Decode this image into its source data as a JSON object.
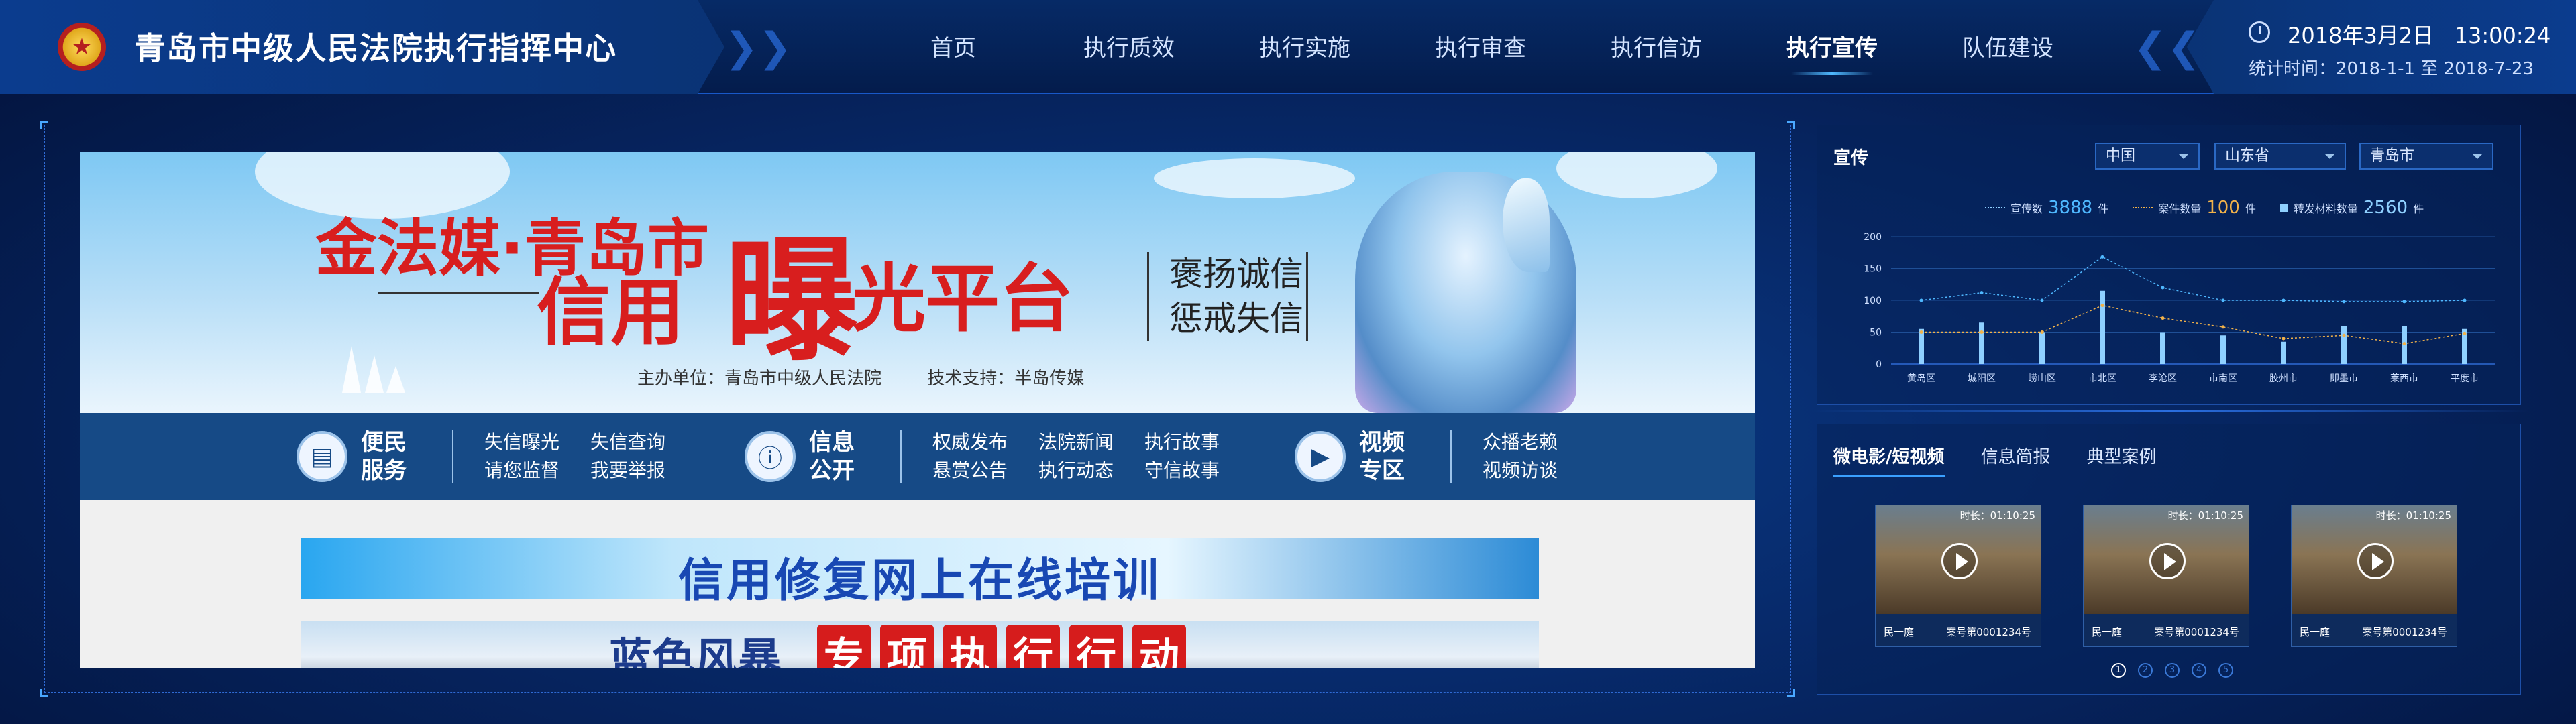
{
  "header": {
    "title": "青岛市中级人民法院执行指挥中心",
    "emblem_icon": "court-emblem-icon",
    "nav": [
      {
        "label": "首页",
        "active": false
      },
      {
        "label": "执行质效",
        "active": false
      },
      {
        "label": "执行实施",
        "active": false
      },
      {
        "label": "执行审查",
        "active": false
      },
      {
        "label": "执行信访",
        "active": false
      },
      {
        "label": "执行宣传",
        "active": true
      },
      {
        "label": "队伍建设",
        "active": false
      }
    ],
    "datetime": "2018年3月2日   13:00:24",
    "stats_range": "统计时间：2018-1-1 至 2018-7-23"
  },
  "banner": {
    "title_prefix": "金法媒·青岛市",
    "title_main_a": "信用",
    "title_main_big": "曝",
    "title_main_b": "光平台",
    "slogan_1": "褒扬诚信",
    "slogan_2": "惩戒失信",
    "sponsor": "主办单位：青岛市中级人民法院",
    "tech": "技术支持：半岛传媒",
    "groups": [
      {
        "icon": "newspaper-icon",
        "head_1": "便民",
        "head_2": "服务",
        "links": [
          "失信曝光",
          "失信查询",
          "请您监督",
          "我要举报"
        ]
      },
      {
        "icon": "info-icon",
        "head_1": "信息",
        "head_2": "公开",
        "links": [
          "权威发布",
          "法院新闻",
          "执行故事",
          "悬赏公告",
          "执行动态",
          "守信故事"
        ]
      },
      {
        "icon": "film-icon",
        "head_1": "视频",
        "head_2": "专区",
        "links": [
          "众播老赖",
          "视频访谈"
        ]
      }
    ],
    "strip_1": "信用修复网上在线培训",
    "strip_2_a": "蓝色风暴",
    "strip_2_b": [
      "专",
      "项",
      "执",
      "行",
      "行",
      "动"
    ]
  },
  "publicity": {
    "title": "宣传",
    "selects": [
      "中国",
      "山东省",
      "青岛市"
    ],
    "legend": [
      {
        "label": "宣传数",
        "value": "3888",
        "unit": "件",
        "color": "#4fb8ff"
      },
      {
        "label": "案件数量",
        "value": "100",
        "unit": "件",
        "color": "#f2b24a"
      },
      {
        "label": "转发材料数量",
        "value": "2560",
        "unit": "件",
        "color": "#8fd0ff"
      }
    ]
  },
  "chart_data": {
    "type": "bar",
    "categories": [
      "黄岛区",
      "城阳区",
      "崂山区",
      "市北区",
      "李沧区",
      "市南区",
      "胶州市",
      "即墨市",
      "莱西市",
      "平度市"
    ],
    "ylim": [
      0,
      200
    ],
    "yticks": [
      0,
      50,
      100,
      150,
      200
    ],
    "series": [
      {
        "name": "宣传数",
        "type": "line",
        "values": [
          100,
          112,
          100,
          168,
          120,
          100,
          100,
          98,
          98,
          100
        ]
      },
      {
        "name": "案件数量",
        "type": "line",
        "values": [
          50,
          50,
          50,
          92,
          72,
          58,
          40,
          45,
          32,
          48
        ]
      },
      {
        "name": "转发材料数量",
        "type": "bar",
        "values": [
          55,
          65,
          50,
          115,
          50,
          45,
          35,
          60,
          60,
          55
        ]
      }
    ]
  },
  "media": {
    "tabs": [
      {
        "label": "微电影/短视频",
        "active": true
      },
      {
        "label": "信息简报",
        "active": false
      },
      {
        "label": "典型案例",
        "active": false
      }
    ],
    "videos": [
      {
        "duration": "时长：01:10:25",
        "left": "民一庭",
        "right": "案号第0001234号"
      },
      {
        "duration": "时长：01:10:25",
        "left": "民一庭",
        "right": "案号第0001234号"
      },
      {
        "duration": "时长：01:10:25",
        "left": "民一庭",
        "right": "案号第0001234号"
      }
    ],
    "pages": [
      "1",
      "2",
      "3",
      "4",
      "5"
    ],
    "active_page": "1"
  }
}
